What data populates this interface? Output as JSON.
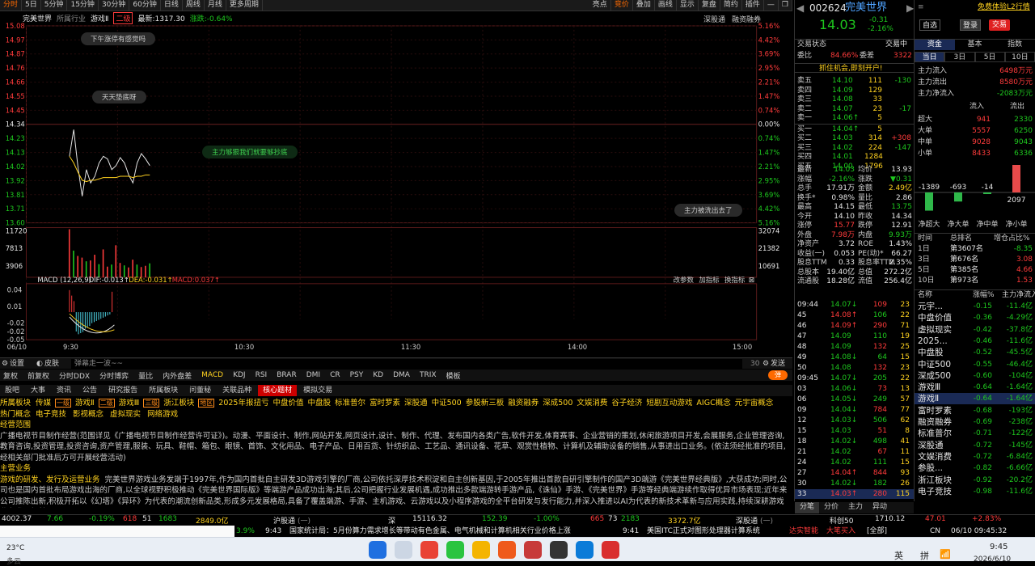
{
  "top_periods": [
    "分时",
    "5日",
    "5分钟",
    "15分钟",
    "30分钟",
    "60分钟",
    "日线",
    "周线",
    "月线",
    "更多周期"
  ],
  "top_tools": [
    "叠加",
    "画线",
    "显示",
    "复盘",
    "简约",
    "插件"
  ],
  "top_toggles": [
    "亮点",
    "竞价"
  ],
  "chart_info": {
    "name": "完美世界",
    "industry": "所属行业",
    "sector": "游戏Ⅱ",
    "badge": "二级",
    "latest": "最新:1317.30",
    "change": "涨跌:-0.64%"
  },
  "chart_right_tabs": [
    "深股通",
    "融资融券"
  ],
  "price_axis": [
    "15.08",
    "14.97",
    "14.87",
    "14.76",
    "14.66",
    "14.55",
    "14.45",
    "14.34",
    "14.23",
    "14.13",
    "14.02",
    "13.92",
    "13.81",
    "13.71",
    "13.60"
  ],
  "pct_axis": [
    "5.16%",
    "4.42%",
    "3.69%",
    "2.95%",
    "2.21%",
    "1.47%",
    "0.74%",
    "0.00%",
    "0.74%",
    "1.47%",
    "2.21%",
    "2.95%",
    "3.69%",
    "4.42%",
    "5.16%"
  ],
  "vol_axis": [
    "11720",
    "7813",
    "3906"
  ],
  "vol_axis_right": [
    "32074",
    "21382",
    "10691"
  ],
  "macd_axis": [
    "0.04",
    "0.01",
    "-0.02",
    "-0.05"
  ],
  "macd_axis_extra": "-0.02",
  "macd_info": {
    "label": "MACD (12,26,9)",
    "dif": "DIF:-0.013↑",
    "dea": "DEA:-0.031↑",
    "macd": "MACD:0.037↑"
  },
  "macd_tools": [
    "改参数",
    "加指标",
    "换指标"
  ],
  "time_axis": [
    "06/10",
    "9:30",
    "10:30",
    "11:30",
    "14:00",
    "15:00"
  ],
  "bubbles": [
    "下午涨停有感觉吗",
    "天天垫底呀",
    "主力够狠我们就要够抄底",
    "主力被洗出去了"
  ],
  "comment_bar": {
    "settings": "设置",
    "skin": "皮肤",
    "placeholder": "弹幕走一波~~",
    "count": "30",
    "send": "发送",
    "danmu": "弹"
  },
  "indicator_tabs": [
    "复权",
    "前复权",
    "分时DDX",
    "分时博弈",
    "量比",
    "内外盘差",
    "MACD",
    "KDJ",
    "RSI",
    "BRAR",
    "DMI",
    "CR",
    "PSY",
    "KD",
    "DMA",
    "TRIX",
    "模板"
  ],
  "f10_tabs": [
    "股吧",
    "大事",
    "资讯",
    "公告",
    "研究报告",
    "所属板块",
    "问董秘",
    "关联品种",
    "核心题材",
    "模拟交易"
  ],
  "content": {
    "line1_label": "所属板块",
    "sectors": [
      "传媒",
      "一级",
      "游戏Ⅱ",
      "二级",
      "游戏Ⅲ",
      "三级",
      "浙江板块",
      "地区",
      "2025年报扭亏",
      "中盘价值",
      "中盘股",
      "标准普尔",
      "富时罗素",
      "深股通",
      "中证500",
      "参股新三板",
      "融资融券",
      "深成500",
      "文娱消费",
      "谷子经济",
      "短剧互动游戏",
      "AIGC概念",
      "元宇宙概念"
    ],
    "line2_label": "热门概念",
    "concepts": [
      "电子竞技",
      "影视概念",
      "虚拟现实",
      "网络游戏"
    ],
    "scope_label": "经营范围",
    "scope": "广播电视节目制作经营(范围详见《广播电视节目制作经营许可证》)。动漫、平面设计、制作,网站开发,网页设计,设计、制作、代理、发布国内各类广告,软件开发,体育赛事、企业营销的策划,休闲旅游项目开发,会展服务,企业管理咨询,教育咨询,投资管理,投资咨询,资产管理,服装、玩具、鞋帽、箱包、眼镜、首饰、文化用品、电子产品、日用百货、针纺织品、工艺品、通讯设备、花草、观赏性植物、计算机及辅助设备的销售,从事进出口业务。(依法须经批准的项目,经相关部门批准后方可开展经营活动)",
    "main_label": "主营业务",
    "main_title": "游戏的研发、发行及运营业务",
    "main": "完美世界游戏业务发端于1997年,作为国内首批自主研发3D游戏引擎的厂商,公司依托深厚技术积淀和自主创新基因,于2005年推出首款自研引擎制作的国产3D端游《完美世界经典版》,大获成功;同时,公司也是国内首批布局游戏出海的厂商,以全球视野积极推动《完美世界国际版》等端游产品成功出海;其后,公司把握行业发展机遇,成功推出多款端游转手游产品,《诛仙》手游、《完美世界》手游等经典端游续作取得优异市场表现;近年来公司推陈出新,积极开拓以《幻塔》《异环》为代表的潮流创新品类,形成多元发展格局,具备了覆盖端游、手游、主机游戏、云游戏以及小程序游戏的全平台研发与发行能力,并深入推进以AI为代表的新技术革新与应用实践,持续深耕游戏业务发展根基。"
  },
  "quote": {
    "code": "002624",
    "name": "完美世界",
    "price": "14.03",
    "chg": "-0.31",
    "pct": "-2.16%"
  },
  "trade": {
    "status_label": "交易状态",
    "status": "交易中",
    "weibi_label": "委比",
    "weibi": "84.66%",
    "weicha_label": "委差",
    "weicha": "3322",
    "banner": "抓住机会,即刻开户!"
  },
  "asks": [
    [
      "卖五",
      "14.10",
      "111",
      "-130"
    ],
    [
      "卖四",
      "14.09",
      "129",
      ""
    ],
    [
      "卖三",
      "14.08",
      "33",
      ""
    ],
    [
      "卖二",
      "14.07",
      "23",
      "-17"
    ],
    [
      "卖一",
      "14.06↑",
      "5",
      ""
    ]
  ],
  "bids": [
    [
      "买一",
      "14.04↑",
      "5",
      ""
    ],
    [
      "买二",
      "14.03",
      "314",
      "+308"
    ],
    [
      "买三",
      "14.02",
      "224",
      "-147"
    ],
    [
      "买四",
      "14.01",
      "1284",
      ""
    ],
    [
      "买五",
      "14.00",
      "1796",
      ""
    ]
  ],
  "stats": [
    [
      "最新",
      "14.03",
      "均价",
      "13.93"
    ],
    [
      "涨幅",
      "-2.16%",
      "涨跌",
      "▼0.31"
    ],
    [
      "总手",
      "17.91万",
      "金额",
      "2.49亿"
    ],
    [
      "换手*",
      "0.98%",
      "量比",
      "2.86"
    ],
    [
      "最高",
      "14.15",
      "最低",
      "13.75"
    ],
    [
      "今开",
      "14.10",
      "昨收",
      "14.34"
    ],
    [
      "涨停",
      "15.77",
      "跌停",
      "12.91"
    ],
    [
      "外盘",
      "7.98万",
      "内盘",
      "9.93万"
    ],
    [
      "净资产",
      "3.72",
      "ROE",
      "1.43%"
    ],
    [
      "收益(一)",
      "0.053",
      "PE(动)*",
      "66.27"
    ],
    [
      "股息TTM",
      "0.33",
      "股息率TTM",
      "2.35%"
    ],
    [
      "总股本",
      "19.40亿",
      "总值",
      "272.2亿"
    ],
    [
      "流通股",
      "18.28亿",
      "流值",
      "256.4亿"
    ]
  ],
  "ticks": [
    [
      "09:44",
      "14.07↓",
      "109",
      "23"
    ],
    [
      "45",
      "14.08↑",
      "106",
      "22"
    ],
    [
      "46",
      "14.09↑",
      "290",
      "71"
    ],
    [
      "47",
      "14.09",
      "110",
      "19"
    ],
    [
      "48",
      "14.09",
      "132",
      "25"
    ],
    [
      "49",
      "14.08↓",
      "64",
      "15"
    ],
    [
      "50",
      "14.08",
      "132",
      "23"
    ],
    [
      "09:45",
      "14.07↓",
      "205",
      "22"
    ],
    [
      "03",
      "14.06↓",
      "73",
      "13"
    ],
    [
      "06",
      "14.05↓",
      "249",
      "57"
    ],
    [
      "09",
      "14.04↓",
      "784",
      "77"
    ],
    [
      "12",
      "14.03↓",
      "506",
      "62"
    ],
    [
      "15",
      "14.03",
      "51",
      "8"
    ],
    [
      "18",
      "14.02↓",
      "498",
      "41"
    ],
    [
      "21",
      "14.02",
      "67",
      "11"
    ],
    [
      "24",
      "14.02",
      "111",
      "15"
    ],
    [
      "27",
      "14.04↑",
      "844",
      "93"
    ],
    [
      "30",
      "14.02↓",
      "182",
      "26"
    ],
    [
      "33",
      "14.03↑",
      "280",
      "115"
    ]
  ],
  "ticks_tabs": [
    "分笔",
    "分价",
    "主力",
    "异动"
  ],
  "far_header": {
    "link": "免费体验L2行情",
    "select": "自选",
    "login": "登录",
    "trade": "交易"
  },
  "far_tabs": [
    "资金",
    "基本",
    "指数"
  ],
  "far_subtabs": [
    "当日",
    "3日",
    "5日",
    "10日"
  ],
  "flows": [
    [
      "主力流入",
      "6498万元"
    ],
    [
      "主力流出",
      "8580万元"
    ],
    [
      "主力净流入",
      "-2083万元"
    ]
  ],
  "flow_header": [
    "流入",
    "流出"
  ],
  "flow_rows": [
    [
      "超大",
      "941",
      "2330"
    ],
    [
      "大单",
      "5557",
      "6250"
    ],
    [
      "中单",
      "9028",
      "9043"
    ],
    [
      "小单",
      "8433",
      "6336"
    ]
  ],
  "net_bars": {
    "labels": [
      "净超大",
      "净大单",
      "净中单",
      "净小单"
    ],
    "values": [
      -1389,
      -693,
      -14,
      2097
    ]
  },
  "history_header": [
    "时间",
    "总排名",
    "增仓占比%"
  ],
  "history": [
    [
      "1日",
      "第3607名",
      "-8.35"
    ],
    [
      "3日",
      "第676名",
      "3.08"
    ],
    [
      "5日",
      "第385名",
      "4.66"
    ],
    [
      "10日",
      "第973名",
      "1.53"
    ]
  ],
  "blocks_header": [
    "名称",
    "涨幅%",
    "主力净流入"
  ],
  "blocks": [
    [
      "元宇...",
      "-0.15",
      "-11.4亿"
    ],
    [
      "中盘价值",
      "-0.36",
      "-4.29亿"
    ],
    [
      "虚拟现实",
      "-0.42",
      "-37.8亿"
    ],
    [
      "2025...",
      "-0.46",
      "-11.6亿"
    ],
    [
      "中盘股",
      "-0.52",
      "-45.5亿"
    ],
    [
      "中证500",
      "-0.55",
      "-46.4亿"
    ],
    [
      "深成500",
      "-0.60",
      "-104亿"
    ],
    [
      "游戏Ⅲ",
      "-0.64",
      "-1.64亿"
    ],
    [
      "游戏Ⅱ",
      "-0.64",
      "-1.64亿"
    ],
    [
      "富时罗素",
      "-0.68",
      "-193亿"
    ],
    [
      "融资融券",
      "-0.69",
      "-238亿"
    ],
    [
      "标准普尔",
      "-0.71",
      "-122亿"
    ],
    [
      "深股通",
      "-0.72",
      "-145亿"
    ],
    [
      "文娱消费",
      "-0.72",
      "-6.84亿"
    ],
    [
      "参股...",
      "-0.82",
      "-6.66亿"
    ],
    [
      "浙江板块",
      "-0.92",
      "-20.2亿"
    ],
    [
      "电子竞技",
      "-0.98",
      "-11.6亿"
    ]
  ],
  "bottom": {
    "idx1": "4002.37",
    "idx1c": "7.66",
    "idx1p": "-0.19%",
    "m1": "618",
    "m2": "51",
    "m3": "1683",
    "amt1": "2849.0亿",
    "hgt": "沪股通",
    "hgt_unit": "(一)",
    "shen": "深",
    "szidx": "15116.32",
    "szc": "152.39",
    "szp": "-1.00%",
    "m4": "665",
    "m5": "73",
    "m6": "2183",
    "amt2": "3372.7亿",
    "sgt": "深股通",
    "sgt_unit": "(一)",
    "kc": "科创50",
    "kcv": "1710.12",
    "kcc": "47.01",
    "kcp": "+2.83%"
  },
  "news": {
    "p": "3.9%",
    "t1": "9:43",
    "n1": "国家统计局：5月份算力需求增长等带动有色金属、电气机械和计算机相关行业价格上涨",
    "t2": "9:41",
    "n2": "美国ITC正式对图形处理器计算系统",
    "ai": "达实智能",
    "tag": "大笔买入",
    "all": "[全部]"
  },
  "taskbar": {
    "temp": "23°C",
    "weather": "多云",
    "lang": "英",
    "ime": "拼",
    "region": "CN",
    "date": "2026/6/10",
    "time": "9:45",
    "clock": "06/10 09:45:32"
  },
  "colors": {
    "red": "#ff3b3b",
    "green": "#1ec81e",
    "yellow": "#ffd21f"
  },
  "intraday_price": [
    14.1,
    14.3,
    14.02,
    13.8,
    14.0,
    13.9,
    13.95,
    14.05,
    14.1,
    14.08,
    14.0,
    14.03,
    14.09,
    14.05,
    13.96,
    13.9,
    14.05,
    14.12,
    14.08,
    14.03
  ],
  "intraday_avg": [
    14.1,
    14.05,
    13.98,
    13.92,
    13.91,
    13.92,
    13.92,
    13.93,
    13.94,
    13.94,
    13.94,
    13.94,
    13.95,
    13.95,
    13.95,
    13.94,
    13.95,
    13.95,
    13.96,
    13.96
  ],
  "intraday_vol": [
    11720,
    6500,
    5200,
    4800,
    3900,
    4100,
    5500,
    3200,
    6800,
    2600,
    3100,
    7813,
    3500,
    2900,
    2400,
    4300,
    3100,
    2500,
    2800,
    3400
  ],
  "macd_bars": [
    0.04,
    0.03,
    0.02,
    -0.035,
    -0.04,
    -0.038,
    -0.036,
    -0.03,
    -0.028,
    -0.025,
    -0.02,
    -0.018,
    -0.016,
    -0.014,
    -0.012,
    -0.01,
    -0.008,
    -0.006,
    -0.004,
    0.037
  ]
}
